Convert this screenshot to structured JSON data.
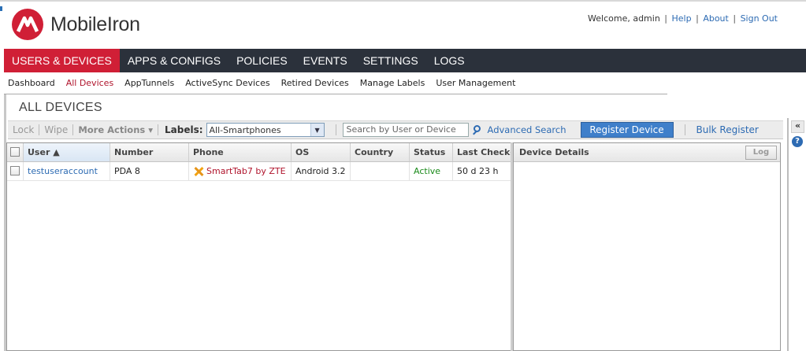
{
  "brand": {
    "name": "MobileIron",
    "color": "#d01f36"
  },
  "top_links": {
    "welcome": "Welcome, admin",
    "help": "Help",
    "about": "About",
    "sign_out": "Sign Out",
    "separator": "|"
  },
  "nav": {
    "items": [
      {
        "label": "USERS & DEVICES",
        "active": true
      },
      {
        "label": "APPS & CONFIGS",
        "active": false
      },
      {
        "label": "POLICIES",
        "active": false
      },
      {
        "label": "EVENTS",
        "active": false
      },
      {
        "label": "SETTINGS",
        "active": false
      },
      {
        "label": "LOGS",
        "active": false
      }
    ]
  },
  "subnav": {
    "items": [
      "Dashboard",
      "All Devices",
      "AppTunnels",
      "ActiveSync Devices",
      "Retired Devices",
      "Manage Labels",
      "User Management"
    ],
    "active": "All Devices"
  },
  "page": {
    "title": "ALL DEVICES"
  },
  "toolbar": {
    "lock": "Lock",
    "wipe": "Wipe",
    "more_actions": "More Actions ▾",
    "labels_label": "Labels:",
    "labels_value": "All-Smartphones",
    "search_placeholder": "Search by User or Device",
    "advanced_search": "Advanced Search",
    "register_device": "Register Device",
    "bulk_register": "Bulk Register"
  },
  "grid": {
    "columns": [
      "User ▲",
      "Number",
      "Phone",
      "OS",
      "Country",
      "Status",
      "Last Check-"
    ],
    "rows": [
      {
        "user": "testuseraccount",
        "number": "PDA 8",
        "phone": "SmartTab7 by ZTE",
        "os": "Android 3.2",
        "country": "",
        "status": "Active",
        "last_checkin": "50 d 23 h"
      }
    ]
  },
  "details": {
    "title": "Device Details",
    "log_button": "Log"
  },
  "side": {
    "collapse": "«",
    "help": "?"
  }
}
